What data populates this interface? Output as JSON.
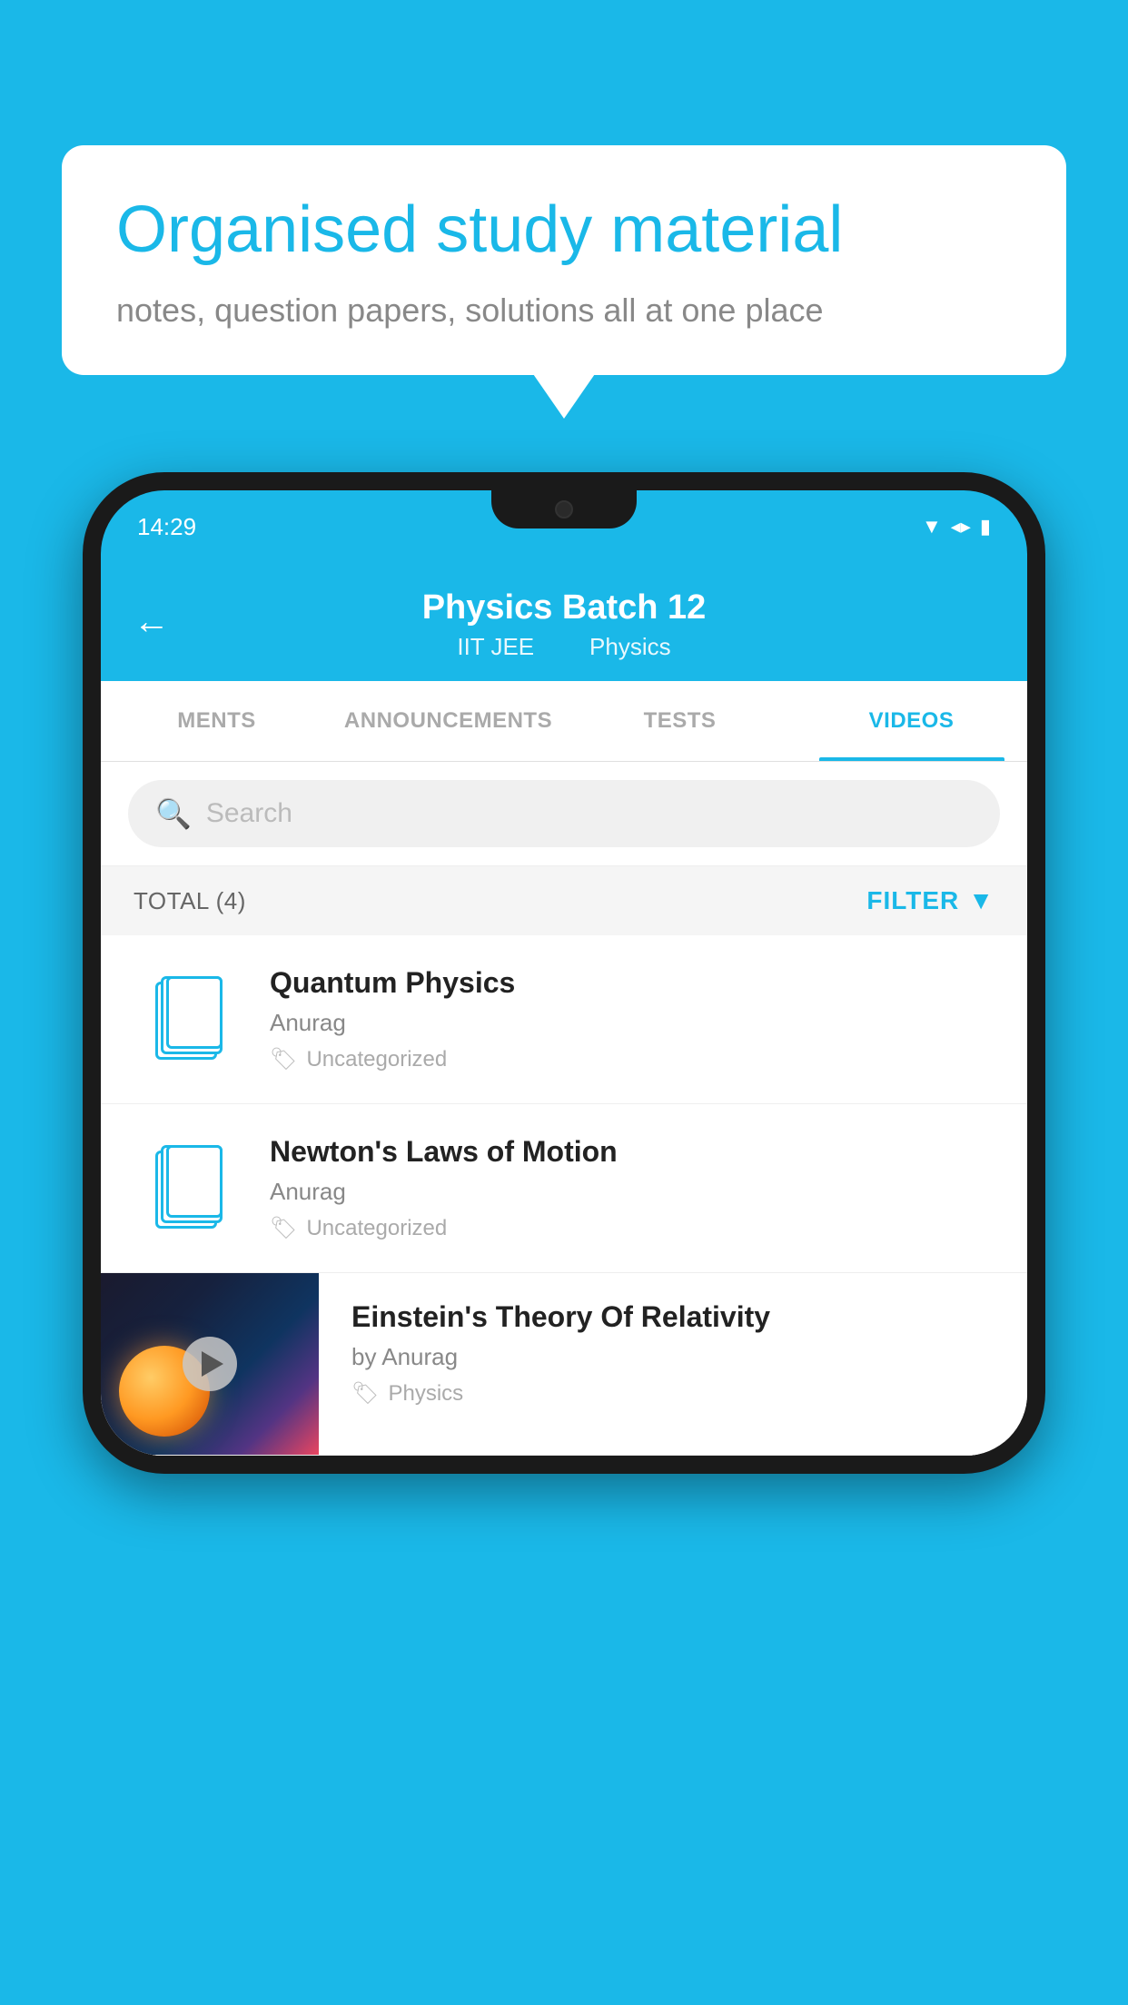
{
  "background_color": "#1ab8e8",
  "bubble": {
    "title": "Organised study material",
    "subtitle": "notes, question papers, solutions all at one place"
  },
  "phone": {
    "status_bar": {
      "time": "14:29"
    },
    "header": {
      "title": "Physics Batch 12",
      "subtitle1": "IIT JEE",
      "subtitle2": "Physics",
      "back_label": "←"
    },
    "tabs": [
      {
        "label": "MENTS",
        "active": false
      },
      {
        "label": "ANNOUNCEMENTS",
        "active": false
      },
      {
        "label": "TESTS",
        "active": false
      },
      {
        "label": "VIDEOS",
        "active": true
      }
    ],
    "search": {
      "placeholder": "Search"
    },
    "filter": {
      "total_label": "TOTAL (4)",
      "filter_label": "FILTER"
    },
    "videos": [
      {
        "title": "Quantum Physics",
        "author": "Anurag",
        "tag": "Uncategorized",
        "has_thumbnail": false
      },
      {
        "title": "Newton's Laws of Motion",
        "author": "Anurag",
        "tag": "Uncategorized",
        "has_thumbnail": false
      },
      {
        "title": "Einstein's Theory Of Relativity",
        "author": "by Anurag",
        "tag": "Physics",
        "has_thumbnail": true
      }
    ]
  }
}
